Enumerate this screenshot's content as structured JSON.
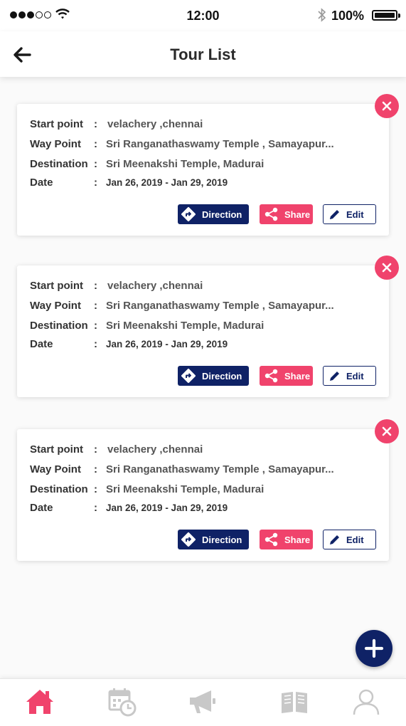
{
  "status_bar": {
    "time": "12:00",
    "battery": "100%",
    "signal_icon": "signal-dots-icon",
    "wifi_icon": "wifi-icon",
    "bluetooth_icon": "bluetooth-icon"
  },
  "header": {
    "title": "Tour List",
    "back_icon": "arrow-left-icon"
  },
  "labels": {
    "start": "Start point",
    "way": "Way Point",
    "destination": "Destination",
    "date": "Date",
    "colon": ":"
  },
  "tours": [
    {
      "start_point": "velachery ,chennai",
      "way_point": "Sri Ranganathaswamy Temple , Samayapur...",
      "destination": "Sri Meenakshi Temple, Madurai",
      "date": "Jan 26, 2019 - Jan 29, 2019",
      "direction_label": "Direction",
      "share_label": "Share",
      "edit_label": "Edit"
    },
    {
      "start_point": "velachery ,chennai",
      "way_point": "Sri Ranganathaswamy Temple , Samayapur...",
      "destination": "Sri Meenakshi Temple, Madurai",
      "date": "Jan 26, 2019 - Jan 29, 2019",
      "direction_label": "Direction",
      "share_label": "Share",
      "edit_label": "Edit"
    },
    {
      "start_point": "velachery ,chennai",
      "way_point": "Sri Ranganathaswamy Temple , Samayapur...",
      "destination": "Sri Meenakshi Temple, Madurai",
      "date": "Jan 26, 2019 - Jan 29, 2019",
      "direction_label": "Direction",
      "share_label": "Share",
      "edit_label": "Edit"
    }
  ],
  "bottom_nav": [
    {
      "icon": "home-icon",
      "active": true
    },
    {
      "icon": "calendar-clock-icon",
      "active": false
    },
    {
      "icon": "megaphone-icon",
      "active": false
    },
    {
      "icon": "book-icon",
      "active": false
    },
    {
      "icon": "user-icon",
      "active": false
    }
  ],
  "colors": {
    "accent": "#f0436c",
    "primary": "#0f2266",
    "inactive_icon": "#c8c8c8"
  }
}
